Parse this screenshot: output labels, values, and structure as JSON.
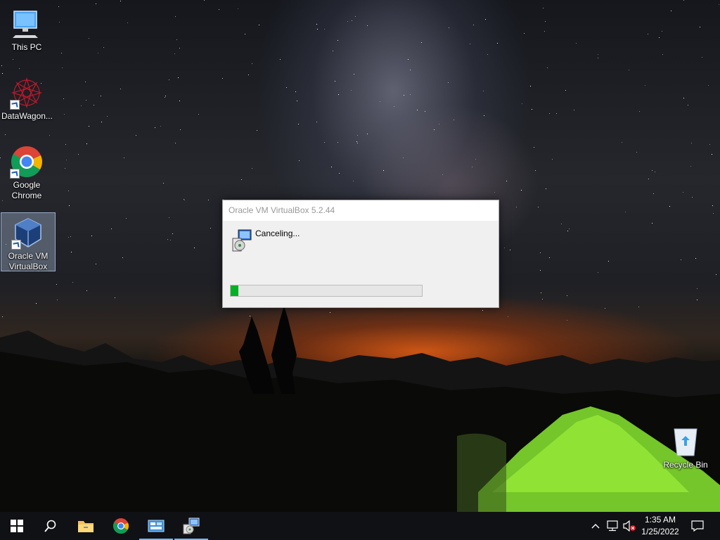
{
  "desktop": {
    "icons": [
      {
        "label": "This PC",
        "icon": "this-pc-icon"
      },
      {
        "label": "DataWagon...",
        "icon": "datawagon-icon"
      },
      {
        "label": "Google Chrome",
        "icon": "chrome-icon"
      },
      {
        "label": "Oracle VM VirtualBox",
        "icon": "virtualbox-icon",
        "selected": true
      },
      {
        "label": "Recycle Bin",
        "icon": "recycle-bin-icon"
      }
    ]
  },
  "dialog": {
    "title": "Oracle VM VirtualBox 5.2.44",
    "message": "Canceling...",
    "progress": 0.04,
    "progress_color": "#06b025"
  },
  "taskbar": {
    "buttons": [
      {
        "name": "start",
        "icon": "windows-logo-icon"
      },
      {
        "name": "search",
        "icon": "search-icon"
      },
      {
        "name": "file-explorer",
        "icon": "folder-icon"
      },
      {
        "name": "chrome",
        "icon": "chrome-icon"
      },
      {
        "name": "control-panel",
        "icon": "control-panel-icon",
        "active": true
      },
      {
        "name": "virtualbox-installer",
        "icon": "installer-icon",
        "active": true
      }
    ],
    "tray": {
      "chevron": "chevron-up-icon",
      "network": "network-icon",
      "volume": "volume-muted-icon",
      "time": "1:35 AM",
      "date": "1/25/2022",
      "notifications": "notification-icon"
    }
  },
  "colors": {
    "taskbar": "#101114",
    "active_indicator": "#7eb4ea"
  }
}
